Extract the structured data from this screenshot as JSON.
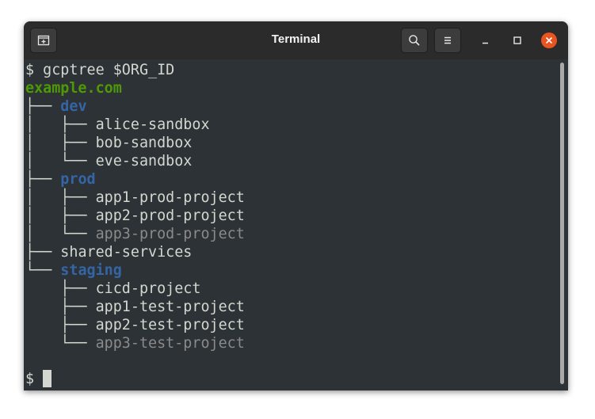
{
  "window": {
    "title": "Terminal"
  },
  "icons": {
    "new_tab": "new-tab-icon",
    "search": "search-icon",
    "menu": "hamburger-menu-icon",
    "minimize": "minimize-icon",
    "maximize": "maximize-icon",
    "close": "close-icon"
  },
  "colors": {
    "background": "#2d3236",
    "org": "#4e9a06",
    "folder": "#3465a4",
    "text": "#d3d7cf",
    "dim": "#8a8a8a",
    "close_button": "#e95420"
  },
  "terminal": {
    "command_prompt": "$ ",
    "command": "gcptree $ORG_ID",
    "tree": {
      "org": "example.com",
      "folders": [
        {
          "name": "dev",
          "branch": "├── ",
          "projects": [
            {
              "branch": "│   ├── ",
              "name": "alice-sandbox",
              "dim": false
            },
            {
              "branch": "│   ├── ",
              "name": "bob-sandbox",
              "dim": false
            },
            {
              "branch": "│   └── ",
              "name": "eve-sandbox",
              "dim": false
            }
          ]
        },
        {
          "name": "prod",
          "branch": "├── ",
          "projects": [
            {
              "branch": "│   ├── ",
              "name": "app1-prod-project",
              "dim": false
            },
            {
              "branch": "│   ├── ",
              "name": "app2-prod-project",
              "dim": false
            },
            {
              "branch": "│   └── ",
              "name": "app3-prod-project",
              "dim": true
            }
          ]
        },
        {
          "name": "shared-services",
          "branch": "├── ",
          "is_project": true,
          "projects": []
        },
        {
          "name": "staging",
          "branch": "└── ",
          "projects": [
            {
              "branch": "    ├── ",
              "name": "cicd-project",
              "dim": false
            },
            {
              "branch": "    ├── ",
              "name": "app1-test-project",
              "dim": false
            },
            {
              "branch": "    ├── ",
              "name": "app2-test-project",
              "dim": false
            },
            {
              "branch": "    └── ",
              "name": "app3-test-project",
              "dim": true
            }
          ]
        }
      ]
    },
    "final_prompt": "$ "
  }
}
